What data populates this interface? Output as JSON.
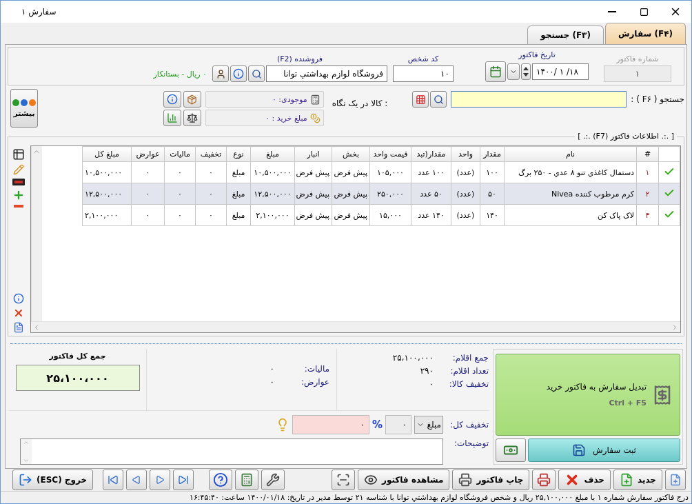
{
  "window": {
    "title": "سفارش ۱"
  },
  "tabs": [
    {
      "label": "سفارش (F۴)",
      "selected": true
    },
    {
      "label": "جستجو (F۳)",
      "selected": false
    }
  ],
  "header": {
    "invoice_number": {
      "label": "شماره فاکتور",
      "value": "۱",
      "disabled": true
    },
    "invoice_date": {
      "label": "تاریخ فاکتور",
      "value": "۱۴۰۰/ ۱ /۱۸"
    },
    "person_code": {
      "label": "کد شخص",
      "value": "۱۰"
    },
    "seller": {
      "label": "فروشنده (F2)",
      "value": "فروشگاه لوازم بهداشتي توانا"
    },
    "balance": "۰ ریال - بستانکار"
  },
  "search": {
    "label": "جستجو ( F۶ ) :",
    "glance_label": ": کالا در یک نگاه",
    "stock": "موجودی: ۰",
    "purchase": "مبلغ خرید : ۰",
    "more_button": "بیشتر"
  },
  "invoice_section": {
    "title": "[ .:. اطلاعات فاکتور (F7) .:. ]"
  },
  "table": {
    "columns": [
      "#",
      "نام",
      "مقدار",
      "واحد",
      "مقدار(تبد",
      "قیمت واحد",
      "بخش",
      "انبار",
      "مبلغ",
      "نوع",
      "تخفیف",
      "مالیات",
      "عوارض",
      "مبلغ کل"
    ],
    "rows": [
      {
        "selected": false,
        "cells": [
          "۱",
          "دستمال کاغذي تنو ۸ عدي - ۲۵۰ برگ",
          "۱۰۰",
          "(عدد)",
          "۱۰۰ عدد",
          "۱۰۵,۰۰۰",
          "پیش فرض",
          "پیش فرض",
          "۱۰,۵۰۰,۰۰۰",
          "مبلغ",
          "۰",
          "۰",
          "۰",
          "۱۰,۵۰۰,۰۰۰"
        ]
      },
      {
        "selected": true,
        "cells": [
          "۲",
          "کرم مرطوب کننده Nivea",
          "۵۰",
          "(عدد)",
          "۵۰ عدد",
          "۲۵۰,۰۰۰",
          "پیش فرض",
          "پیش فرض",
          "۱۲,۵۰۰,۰۰۰",
          "مبلغ",
          "۰",
          "۰",
          "۰",
          "۱۲,۵۰۰,۰۰۰"
        ]
      },
      {
        "selected": false,
        "cells": [
          "۳",
          "لاک پاک کن",
          "۱۴۰",
          "(عدد)",
          "۱۴۰ عدد",
          "۱۵,۰۰۰",
          "پیش فرض",
          "پیش فرض",
          "۲,۱۰۰,۰۰۰",
          "مبلغ",
          "۰",
          "۰",
          "۰",
          "۲,۱۰۰,۰۰۰"
        ]
      }
    ]
  },
  "totals": {
    "grand_total_label": "جمع کل فاکتور",
    "grand_total": "۲۵،۱۰۰،۰۰۰",
    "summary": [
      {
        "label": "جمع اقلام:",
        "value": "۲۵،۱۰۰،۰۰۰"
      },
      {
        "label": "تعداد اقلام:",
        "value": "۲۹۰"
      },
      {
        "label": "تخفیف کالا:",
        "value": "۰"
      }
    ],
    "charges": [
      {
        "label": "مالیات:",
        "value": "۰"
      },
      {
        "label": "عوارض:",
        "value": "۰"
      }
    ],
    "discount": {
      "label": "تخفیف کل:",
      "type": "مبلغ",
      "percent": "۰",
      "percent_sign": "%",
      "amount": "۰"
    },
    "notes_label": "توضیحات:"
  },
  "actions": {
    "convert": {
      "label": "تبدیل سفارش به فاکتور خرید",
      "shortcut": "Ctrl + F5"
    },
    "save": "ثبت سفارش"
  },
  "toolbar": {
    "new": "جدید",
    "delete": "حذف",
    "print_invoice": "چاپ فاکتور",
    "view_invoice": "مشاهده فاکتور",
    "exit": "خروج (ESC)"
  },
  "status_bar": "درج فاکتور سفارش شماره ۱ با مبلغ ۲۵,۱۰۰,۰۰۰ ریال و شخص فروشگاه لوازم بهداشتي توانا با شناسه ۲۱ توسط مدیر در تاریخ: ۱۴۰۰/۰۱/۱۸ ساعت: ۱۶:۴۵:۴۰"
}
